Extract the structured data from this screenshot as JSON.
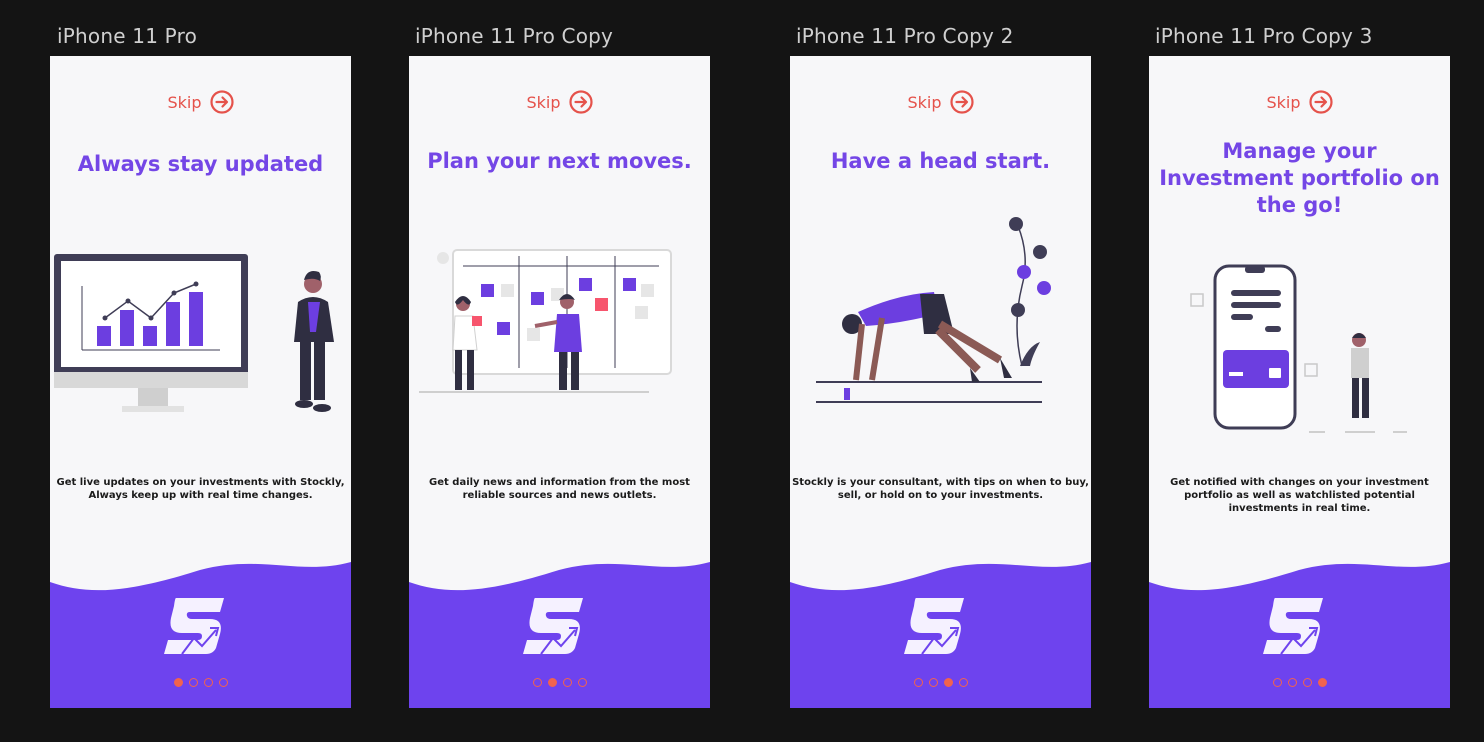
{
  "colors": {
    "canvas": "#141414",
    "screen": "#f7f7f9",
    "brand_purple": "#7446e6",
    "skip_red": "#e5524b",
    "dot_orange": "#f1634e"
  },
  "frames": [
    {
      "label": "iPhone 11 Pro",
      "skip": "Skip",
      "headline": "Always stay updated",
      "body": "Get live updates on your investments with Stockly, Always keep up with real time changes.",
      "active_dot": 0,
      "illustration": "monitor-growth-chart-illustration"
    },
    {
      "label": "iPhone 11 Pro Copy",
      "skip": "Skip",
      "headline": "Plan your next moves.",
      "body": "Get daily news and information from the most reliable sources and news outlets.",
      "active_dot": 1,
      "illustration": "kanban-board-planning-illustration"
    },
    {
      "label": "iPhone 11 Pro Copy 2",
      "skip": "Skip",
      "headline": "Have a head start.",
      "body": "Stockly is your consultant, with tips on when to buy, sell, or hold on to your investments.",
      "active_dot": 2,
      "illustration": "runner-start-line-illustration"
    },
    {
      "label": "iPhone 11 Pro Copy 3",
      "skip": "Skip",
      "headline": "Manage your Investment portfolio  on the go!",
      "body": "Get notified with changes on your investment portfolio as well as watchlisted potential investments in real time.",
      "active_dot": 3,
      "illustration": "phone-wallet-card-illustration"
    }
  ],
  "icons": {
    "skip": "arrow-right-circle-icon",
    "logo": "stockly-s-logo"
  }
}
